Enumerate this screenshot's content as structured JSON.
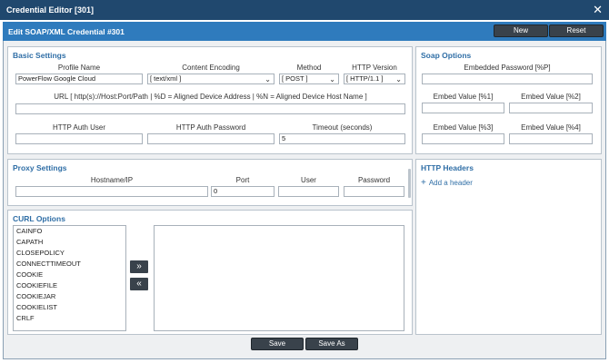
{
  "window": {
    "title": "Credential Editor [301]"
  },
  "editor": {
    "title": "Edit SOAP/XML Credential #301",
    "new_label": "New",
    "reset_label": "Reset"
  },
  "basic": {
    "title": "Basic Settings",
    "profile_label": "Profile Name",
    "profile_value": "PowerFlow Google Cloud",
    "encoding_label": "Content Encoding",
    "encoding_value": "[ text/xml ]",
    "method_label": "Method",
    "method_value": "[ POST ]",
    "http_version_label": "HTTP Version",
    "http_version_value": "[ HTTP/1.1 ]",
    "url_label": "URL [ http(s)://Host:Port/Path | %D = Aligned Device Address | %N = Aligned Device Host Name ]",
    "url_value": "",
    "auth_user_label": "HTTP Auth User",
    "auth_user_value": "",
    "auth_password_label": "HTTP Auth Password",
    "auth_password_value": "",
    "timeout_label": "Timeout (seconds)",
    "timeout_value": "5"
  },
  "soap": {
    "title": "Soap Options",
    "embedded_password_label": "Embedded Password [%P]",
    "embed1_label": "Embed Value [%1]",
    "embed2_label": "Embed Value [%2]",
    "embed3_label": "Embed Value [%3]",
    "embed4_label": "Embed Value [%4]"
  },
  "proxy": {
    "title": "Proxy Settings",
    "hostname_label": "Hostname/IP",
    "port_label": "Port",
    "port_value": "0",
    "user_label": "User",
    "password_label": "Password"
  },
  "headers": {
    "title": "HTTP Headers",
    "add_label": "Add a header"
  },
  "curl": {
    "title": "CURL Options",
    "available": [
      "CAINFO",
      "CAPATH",
      "CLOSEPOLICY",
      "CONNECTTIMEOUT",
      "COOKIE",
      "COOKIEFILE",
      "COOKIEJAR",
      "COOKIELIST",
      "CRLF"
    ],
    "add_symbol": "»",
    "remove_symbol": "«"
  },
  "footer": {
    "save_label": "Save",
    "save_as_label": "Save As"
  }
}
